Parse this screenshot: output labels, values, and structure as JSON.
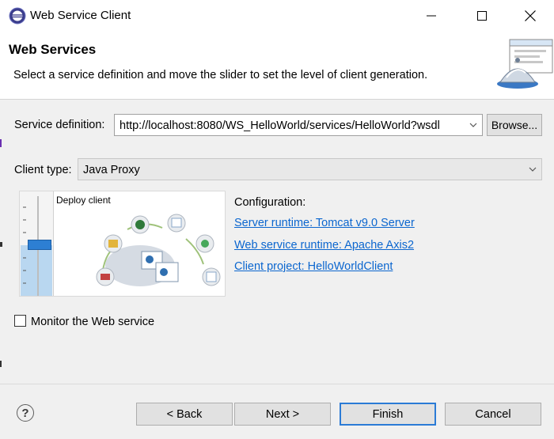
{
  "window": {
    "title": "Web Service Client"
  },
  "banner": {
    "title": "Web Services",
    "description": "Select a service definition and move the slider to set the level of client generation."
  },
  "form": {
    "service_definition_label": "Service definition:",
    "service_definition_value": "http://localhost:8080/WS_HelloWorld/services/HelloWorld?wsdl",
    "browse_label": "Browse...",
    "client_type_label": "Client type:",
    "client_type_value": "Java Proxy"
  },
  "slider": {
    "level_label": "Deploy client",
    "level_fraction": 0.5
  },
  "configuration": {
    "label": "Configuration:",
    "links": [
      "Server runtime: Tomcat v9.0 Server",
      "Web service runtime: Apache Axis2",
      "Client project: HelloWorldClient"
    ]
  },
  "monitor": {
    "label": "Monitor the Web service",
    "checked": false
  },
  "buttons": {
    "back": "< Back",
    "next": "Next >",
    "finish": "Finish",
    "cancel": "Cancel",
    "help": "?"
  },
  "colors": {
    "link": "#0b66cf",
    "slider_accent": "#2d7fd3",
    "default_button_border": "#2b7bd6"
  }
}
